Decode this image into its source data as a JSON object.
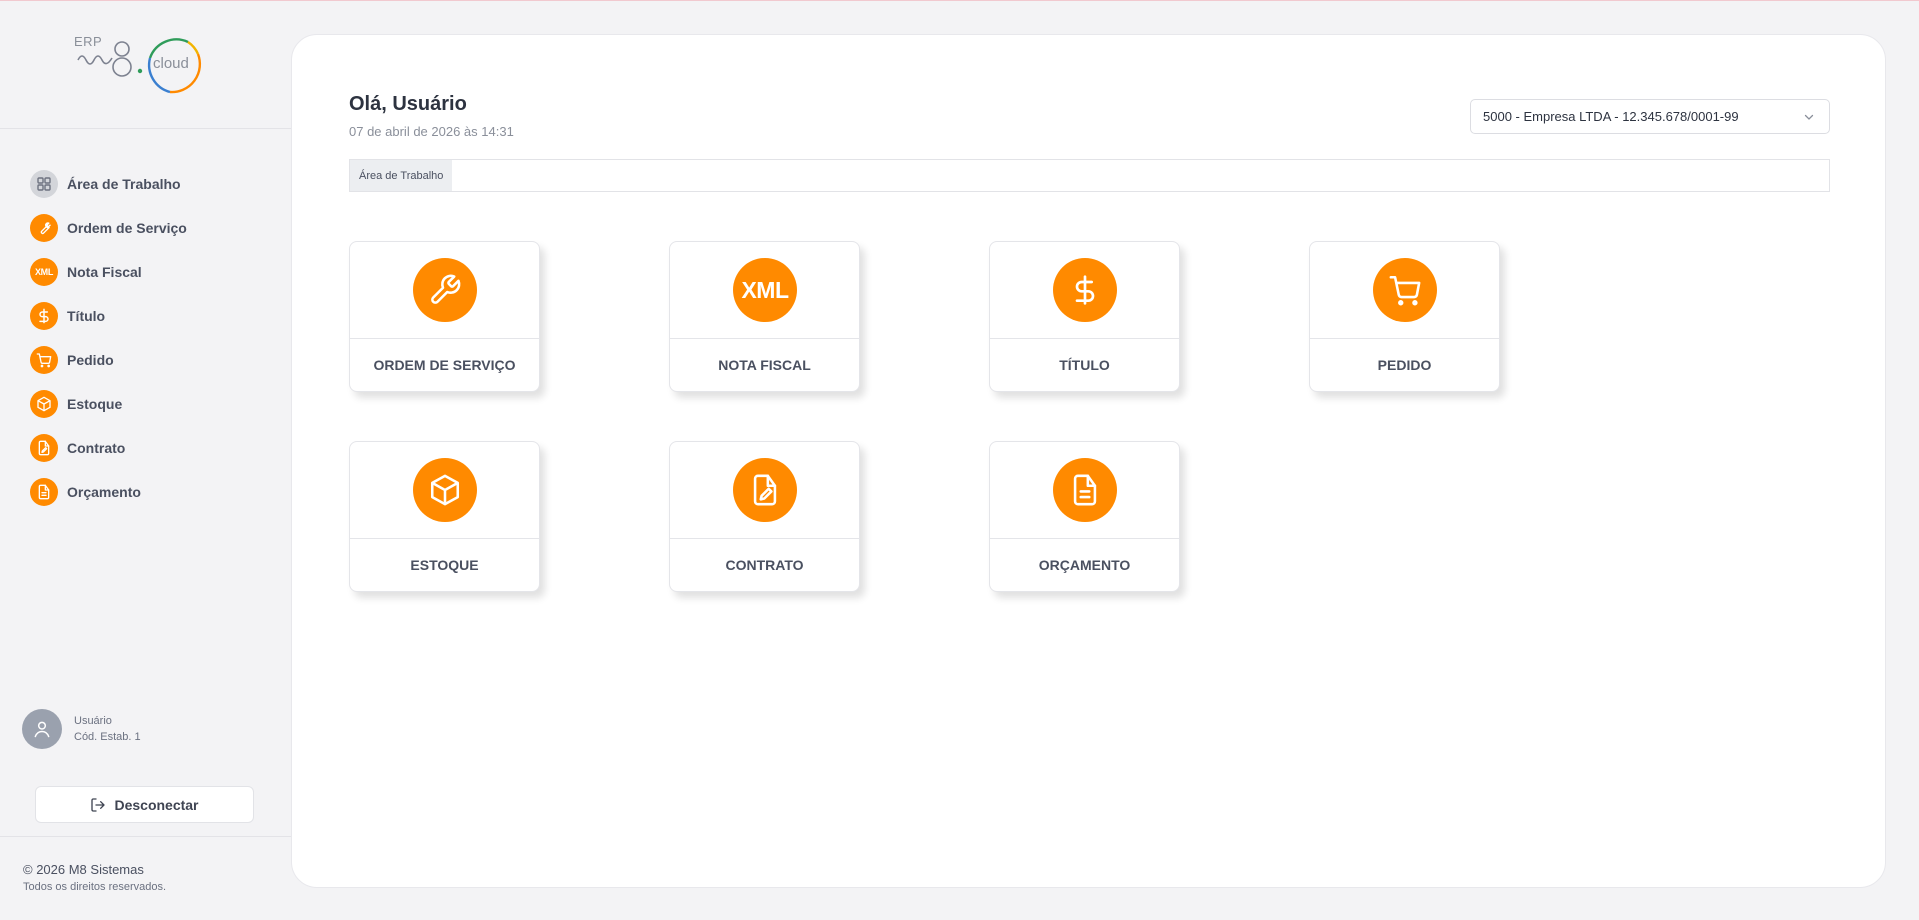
{
  "brand": {
    "erp_label": "ERP",
    "cloud_label": "cloud",
    "accent": "#ff8a00"
  },
  "sidebar": {
    "items": [
      {
        "label": "Área de Trabalho",
        "icon": "grid-icon"
      },
      {
        "label": "Ordem de Serviço",
        "icon": "wrench-icon"
      },
      {
        "label": "Nota Fiscal",
        "icon": "xml-icon",
        "icon_text": "XML"
      },
      {
        "label": "Título",
        "icon": "dollar-icon"
      },
      {
        "label": "Pedido",
        "icon": "cart-icon"
      },
      {
        "label": "Estoque",
        "icon": "box-icon"
      },
      {
        "label": "Contrato",
        "icon": "contract-icon"
      },
      {
        "label": "Orçamento",
        "icon": "document-icon"
      }
    ],
    "user": {
      "name": "Usuário",
      "establishment": "Cód. Estab. 1"
    },
    "logout_label": "Desconectar",
    "footer": {
      "copyright": "© 2026 M8 Sistemas",
      "rights": "Todos os direitos reservados."
    }
  },
  "header": {
    "greeting": "Olá, Usuário",
    "datetime": "07 de abril de 2026 às 14:31",
    "company_select": {
      "value": "5000 - Empresa LTDA - 12.345.678/0001-99"
    }
  },
  "breadcrumb": {
    "items": [
      "Área de Trabalho"
    ]
  },
  "cards": [
    {
      "label": "ORDEM DE SERVIÇO",
      "icon": "wrench-icon"
    },
    {
      "label": "NOTA FISCAL",
      "icon": "xml-icon",
      "icon_text": "XML"
    },
    {
      "label": "TÍTULO",
      "icon": "dollar-icon"
    },
    {
      "label": "PEDIDO",
      "icon": "cart-icon"
    },
    {
      "label": "ESTOQUE",
      "icon": "box-icon"
    },
    {
      "label": "CONTRATO",
      "icon": "contract-icon"
    },
    {
      "label": "ORÇAMENTO",
      "icon": "document-icon"
    }
  ]
}
